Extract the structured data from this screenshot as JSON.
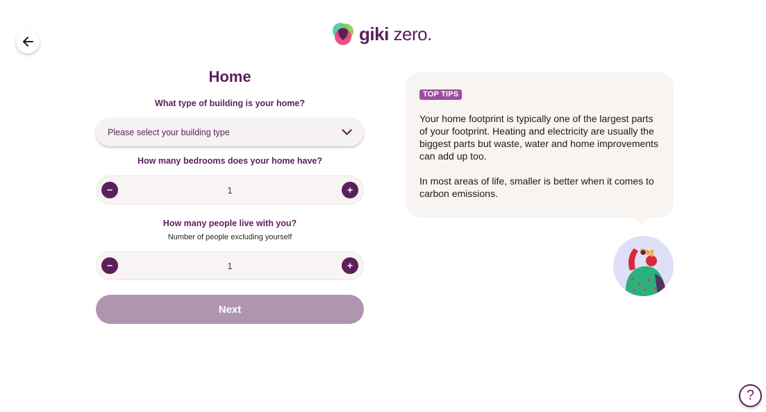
{
  "header": {
    "logo_brand": "giki",
    "logo_suffix": "zero."
  },
  "form": {
    "title": "Home",
    "building_question": "What type of building is your home?",
    "building_placeholder": "Please select your building type",
    "bedrooms_question": "How many bedrooms does your home have?",
    "bedrooms_value": "1",
    "people_question": "How many people live with you?",
    "people_hint": "Number of people excluding yourself",
    "people_value": "1",
    "next_label": "Next"
  },
  "tips": {
    "badge": "TOP TIPS",
    "paragraphs": [
      "Your home footprint is typically one of the largest parts of your footprint. Heating and electricity are usually the biggest parts but waste, water and home improvements can add up too.",
      "In most areas of life, smaller is better when it comes to carbon emissions."
    ]
  },
  "help": {
    "label": "?"
  },
  "icons": {
    "back": "arrow-left-icon",
    "dropdown": "chevron-down-icon",
    "decrement": "minus-icon",
    "increment": "plus-icon",
    "help": "question-icon"
  },
  "colors": {
    "brand_purple": "#5b1f5c",
    "badge_purple": "#9b4ea1",
    "next_disabled": "#b095b1",
    "card_bg": "#f8f4f2"
  }
}
